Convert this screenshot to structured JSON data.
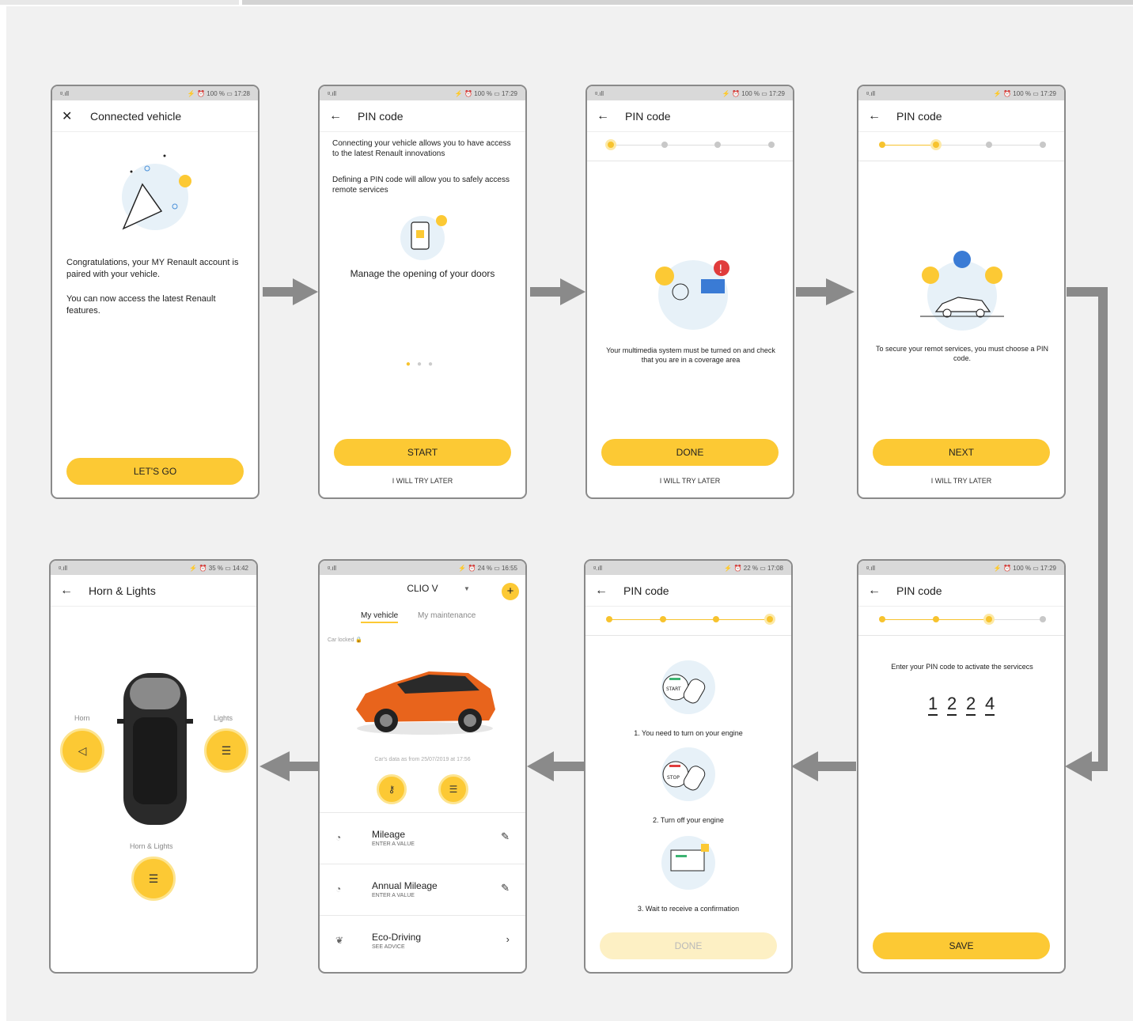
{
  "phones": {
    "p1": {
      "status_left": "ᵍ.ıll",
      "status_right": "⚡ ⏰ 100 % ▭ 17:28",
      "title": "Connected vehicle",
      "msg1": "Congratulations, your MY Renault account is paired with your vehicle.",
      "msg2": "You can now access the latest Renault features.",
      "button": "LET'S GO"
    },
    "p2": {
      "status_left": "ᵍ.ıll",
      "status_right": "⚡ ⏰ 100 % ▭ 17:29",
      "title": "PIN code",
      "msg1": "Connecting your vehicle allows you to have access to the latest Renault innovations",
      "msg2": "Defining a PIN code will allow you to safely access remote services",
      "caption": "Manage the opening of your doors",
      "button": "START",
      "later": "I WILL TRY LATER"
    },
    "p3": {
      "status_left": "ᵍ.ıll",
      "status_right": "⚡ ⏰ 100 % ▭ 17:29",
      "title": "PIN code",
      "msg": "Your multimedia system must be turned on and check that you are in a coverage area",
      "button": "DONE",
      "later": "I WILL TRY LATER"
    },
    "p4": {
      "status_left": "ᵍ.ıll",
      "status_right": "⚡ ⏰ 100 % ▭ 17:29",
      "title": "PIN code",
      "msg": "To secure your remot services, you must choose a PIN code.",
      "button": "NEXT",
      "later": "I WILL TRY LATER"
    },
    "p5": {
      "status_left": "ᵍ.ıll",
      "status_right": "⚡ ⏰ 100 % ▭ 17:29",
      "title": "PIN code",
      "msg": "Enter your PIN code to activate the servicecs",
      "pin": [
        "1",
        "2",
        "2",
        "4"
      ],
      "button": "SAVE"
    },
    "p6": {
      "status_left": "ᵍ.ıll",
      "status_right": "⚡ ⏰ 22 % ▭ 17:08",
      "title": "PIN code",
      "step1": "1. You need to turn on your engine",
      "step2": "2. Turn off your engine",
      "step3": "3. Wait to receive a confirmation",
      "button": "DONE",
      "start_label": "START",
      "stop_label": "STOP"
    },
    "p7": {
      "status_left": "ᵍ.ıll",
      "status_right": "⚡ ⏰ 24 % ▭ 16:55",
      "vehicle": "CLIO V",
      "tab1": "My vehicle",
      "tab2": "My maintenance",
      "locked": "Car locked",
      "data_from": "Car's data as from 25/07/2019 at 17:56",
      "rows": [
        {
          "t1": "Mileage",
          "t2": "ENTER A VALUE"
        },
        {
          "t1": "Annual Mileage",
          "t2": "ENTER A VALUE"
        },
        {
          "t1": "Eco-Driving",
          "t2": "SEE ADVICE"
        }
      ]
    },
    "p8": {
      "status_left": "ᵍ.ıll",
      "status_right": "⚡ ⏰ 35 % ▭ 14:42",
      "title": "Horn & Lights",
      "horn": "Horn",
      "lights": "Lights",
      "horn_lights": "Horn & Lights"
    }
  },
  "colors": {
    "accent": "#fcc934",
    "arrow": "#8a8a8a"
  }
}
